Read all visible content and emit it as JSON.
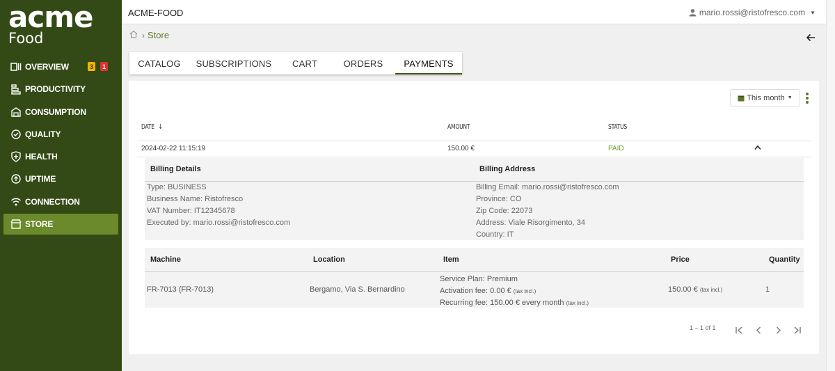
{
  "brand": {
    "line1": "acme",
    "line2": "Food"
  },
  "sidebar": {
    "items": [
      {
        "label": "OVERVIEW",
        "icon": "overview-icon",
        "badges": [
          "3",
          "1"
        ]
      },
      {
        "label": "PRODUCTIVITY",
        "icon": "productivity-icon"
      },
      {
        "label": "CONSUMPTION",
        "icon": "consumption-icon"
      },
      {
        "label": "QUALITY",
        "icon": "quality-icon"
      },
      {
        "label": "HEALTH",
        "icon": "health-icon"
      },
      {
        "label": "UPTIME",
        "icon": "uptime-icon"
      },
      {
        "label": "CONNECTION",
        "icon": "wifi-icon"
      },
      {
        "label": "STORE",
        "icon": "store-icon",
        "active": true
      }
    ],
    "colors": {
      "background": "#344a16",
      "active": "#6b8a2b",
      "badge_warning": "#f4b400",
      "badge_error": "#e03131"
    }
  },
  "header": {
    "title": "ACME-FOOD",
    "user": "mario.rossi@ristofresco.com"
  },
  "breadcrumb": {
    "current": "Store"
  },
  "tabs": [
    {
      "label": "CATALOG"
    },
    {
      "label": "SUBSCRIPTIONS"
    },
    {
      "label": "CART"
    },
    {
      "label": "ORDERS"
    },
    {
      "label": "PAYMENTS",
      "active": true
    }
  ],
  "filter": {
    "label": "This month"
  },
  "table": {
    "headers": {
      "date": "DATE",
      "amount": "AMOUNT",
      "status": "STATUS"
    },
    "rows": [
      {
        "date": "2024-02-22 11:15:19",
        "amount": "150.00 €",
        "status": "PAID",
        "expanded": true
      }
    ]
  },
  "details": {
    "billing_details_title": "Billing Details",
    "billing_address_title": "Billing Address",
    "billing_details": [
      "Type: BUSINESS",
      "Business Name: Ristofresco",
      "VAT Number: IT12345678",
      "Executed by: mario.rossi@ristofresco.com"
    ],
    "billing_address": [
      "Billing Email: mario.rossi@ristofresco.com",
      "Province: CO",
      "Zip Code: 22073",
      "Address: Viale Risorgimento, 34",
      "Country: IT"
    ]
  },
  "items": {
    "headers": {
      "machine": "Machine",
      "location": "Location",
      "item": "Item",
      "price": "Price",
      "quantity": "Quantity"
    },
    "rows": [
      {
        "machine": "FR-7013 (FR-7013)",
        "location": "Bergamo, Via S. Bernardino",
        "item_line1": "Service Plan: Premium",
        "item_line2": "Activation fee: 0.00 €",
        "item_line3": "Recurring fee: 150.00 € every month",
        "tax_note": "(tax incl.)",
        "price": "150.00 €",
        "quantity": "1"
      }
    ]
  },
  "pagination": {
    "range": "1 – 1 of 1"
  },
  "colors": {
    "accent": "#5a7a25",
    "paid": "#6b9a2b"
  }
}
